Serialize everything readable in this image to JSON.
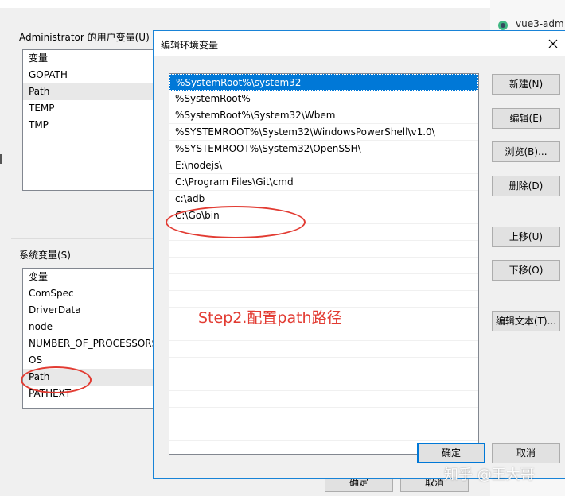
{
  "background_window": {
    "user_vars_label": "Administrator 的用户变量(U)",
    "user_vars": [
      "变量",
      "GOPATH",
      "Path",
      "TEMP",
      "TMP"
    ],
    "system_vars_label": "系统变量(S)",
    "system_vars": [
      "变量",
      "ComSpec",
      "DriverData",
      "node",
      "NUMBER_OF_PROCESSORS",
      "OS",
      "Path",
      "PATHEXT"
    ],
    "ok_label": "确定",
    "cancel_label": "取消"
  },
  "browser_tab": {
    "label": "vue3-adm"
  },
  "dialog": {
    "title": "编辑环境变量",
    "paths": [
      "%SystemRoot%\\system32",
      "%SystemRoot%",
      "%SystemRoot%\\System32\\Wbem",
      "%SYSTEMROOT%\\System32\\WindowsPowerShell\\v1.0\\",
      "%SYSTEMROOT%\\System32\\OpenSSH\\",
      "E:\\nodejs\\",
      "C:\\Program Files\\Git\\cmd",
      "c:\\adb",
      "C:\\Go\\bin"
    ],
    "buttons": {
      "new": "新建(N)",
      "edit": "编辑(E)",
      "browse": "浏览(B)...",
      "delete": "删除(D)",
      "move_up": "上移(U)",
      "move_down": "下移(O)",
      "edit_text": "编辑文本(T)...",
      "ok": "确定",
      "cancel": "取消"
    },
    "annotation": "Step2.配置path路径"
  },
  "watermark": "知乎 @王大哥",
  "colors": {
    "accent": "#0078d7",
    "annotation_red": "#e23b32",
    "vue_green": "#41b883"
  }
}
